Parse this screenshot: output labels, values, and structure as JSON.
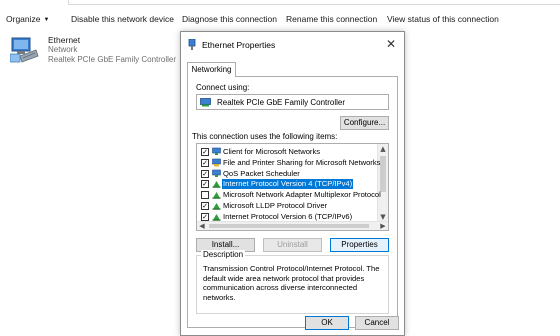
{
  "commandbar": {
    "organize": "Organize",
    "disable": "Disable this network device",
    "diagnose": "Diagnose this connection",
    "rename": "Rename this connection",
    "view_status": "View status of this connection"
  },
  "ethernet_item": {
    "name": "Ethernet",
    "network": "Network",
    "adapter": "Realtek PCIe GbE Family Controller"
  },
  "dialog": {
    "title": "Ethernet Properties",
    "close": "✕",
    "tab": "Networking",
    "connect_using_label": "Connect using:",
    "adapter_name": "Realtek PCIe GbE Family Controller",
    "configure": "Configure...",
    "items_label": "This connection uses the following items:",
    "items": [
      {
        "label": "Client for Microsoft Networks",
        "checked": true,
        "icon": "network-client-icon"
      },
      {
        "label": "File and Printer Sharing for Microsoft Networks",
        "checked": true,
        "icon": "file-sharing-icon"
      },
      {
        "label": "QoS Packet Scheduler",
        "checked": true,
        "icon": "qos-icon"
      },
      {
        "label": "Internet Protocol Version 4 (TCP/IPv4)",
        "checked": true,
        "icon": "protocol-icon"
      },
      {
        "label": "Microsoft Network Adapter Multiplexor Protocol",
        "checked": false,
        "icon": "protocol-icon"
      },
      {
        "label": "Microsoft LLDP Protocol Driver",
        "checked": true,
        "icon": "protocol-icon"
      },
      {
        "label": "Internet Protocol Version 6 (TCP/IPv6)",
        "checked": true,
        "icon": "protocol-icon"
      }
    ],
    "install": "Install...",
    "uninstall": "Uninstall",
    "properties": "Properties",
    "description_title": "Description",
    "description_text": "Transmission Control Protocol/Internet Protocol. The default wide area network protocol that provides communication across diverse interconnected networks.",
    "ok": "OK",
    "cancel": "Cancel"
  },
  "colors": {
    "selection": "#0078d7",
    "button_face": "#e1e1e1",
    "border": "#adadad"
  }
}
